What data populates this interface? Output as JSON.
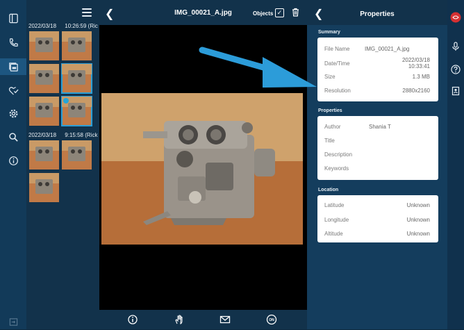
{
  "viewer": {
    "filename": "IMG_00021_A.jpg",
    "objects_label": "Objects"
  },
  "gallery": {
    "groups": [
      {
        "date": "2022/03/18",
        "time": "10:26:59",
        "author_trunc": "(Ric"
      },
      {
        "date": "2022/03/18",
        "time": "9:15:58",
        "author_trunc": "(Rick"
      }
    ]
  },
  "properties": {
    "title": "Properties",
    "summary": {
      "heading": "Summary",
      "file_name_label": "File Name",
      "file_name": "IMG_00021_A.jpg",
      "datetime_label": "Date/Time",
      "date": "2022/03/18",
      "time": "10:33:41",
      "size_label": "Size",
      "size": "1.3 MB",
      "resolution_label": "Resolution",
      "resolution": "2880x2160"
    },
    "props": {
      "heading": "Properties",
      "author_label": "Author",
      "author": "Shania T",
      "title_label": "Title",
      "description_label": "Description",
      "keywords_label": "Keywords"
    },
    "location": {
      "heading": "Location",
      "latitude_label": "Latitude",
      "latitude": "Unknown",
      "longitude_label": "Longitude",
      "longitude": "Unknown",
      "altitude_label": "Altitude",
      "altitude": "Unknown"
    }
  },
  "icons": {
    "rail": [
      "panel-icon",
      "phone-icon",
      "gallery-icon",
      "heart-check-icon",
      "settings-icon",
      "search-icon",
      "info-icon",
      "exit-icon"
    ],
    "footer": [
      "info-icon",
      "hand-icon",
      "mail-icon",
      "on-icon"
    ],
    "edge": [
      "record-icon",
      "mic-icon",
      "help-icon",
      "contacts-icon"
    ]
  },
  "colors": {
    "accent": "#2a9fd8",
    "arrow": "#2c9cd9"
  }
}
